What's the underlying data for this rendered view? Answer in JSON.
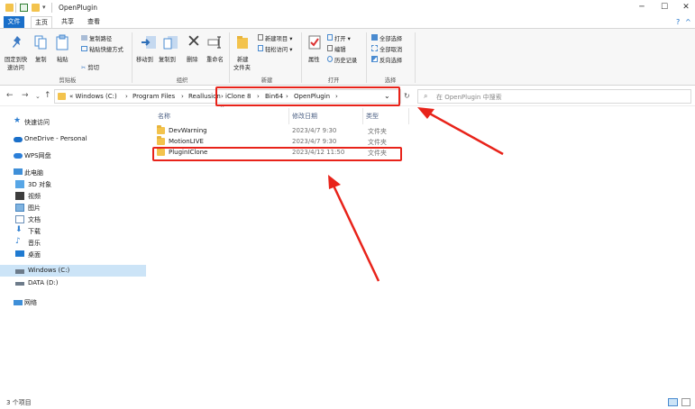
{
  "window": {
    "title": "OpenPlugin",
    "controls": {
      "minimize": "─",
      "maximize": "☐",
      "close": "✕"
    }
  },
  "tabs": [
    {
      "label": "文件",
      "kind": "file"
    },
    {
      "label": "主页",
      "kind": "active"
    },
    {
      "label": "共享",
      "kind": "normal"
    },
    {
      "label": "查看",
      "kind": "normal"
    }
  ],
  "ribbon": {
    "pin_quick_access": [
      "固定到快",
      "速访问"
    ],
    "copy": "复制",
    "paste": "粘贴",
    "copy_path": "复制路径",
    "paste_shortcut": "粘贴快捷方式",
    "cut": "剪切",
    "move_to": "移动到",
    "copy_to": "复制到",
    "delete": "删除",
    "rename": "重命名",
    "new_folder": [
      "新建",
      "文件夹"
    ],
    "new_item": "新建项目 ▾",
    "easy_access": "轻松访问 ▾",
    "properties": "属性",
    "open": "打开 ▾",
    "edit": "编辑",
    "history": "历史记录",
    "select_all": "全部选择",
    "select_none": "全部取消",
    "invert_selection": "反向选择",
    "groups": {
      "clipboard": "剪贴板",
      "organize": "组织",
      "new": "新建",
      "open": "打开",
      "select": "选择"
    }
  },
  "address": {
    "crumbs_left": [
      "«  Windows (C:)",
      "›",
      "Program Files",
      "›",
      "Reallusion"
    ],
    "crumbs_right": [
      "› iClone 8",
      "›",
      "Bin64",
      "›",
      "OpenPlugin",
      "›"
    ],
    "search_placeholder": "在 OpenPlugin 中搜索"
  },
  "sidebar": {
    "items": [
      {
        "label": "快速访问",
        "icon": "star-icon"
      },
      {
        "label": "OneDrive - Personal",
        "icon": "cloud-icon"
      },
      {
        "label": "WPS网盘",
        "icon": "cloud-icon"
      },
      {
        "label": "此电脑",
        "icon": "computer-icon"
      },
      {
        "label": "3D 对象",
        "icon": "cube-icon"
      },
      {
        "label": "视频",
        "icon": "video-icon"
      },
      {
        "label": "图片",
        "icon": "picture-icon"
      },
      {
        "label": "文档",
        "icon": "document-icon"
      },
      {
        "label": "下载",
        "icon": "download-icon"
      },
      {
        "label": "音乐",
        "icon": "music-icon"
      },
      {
        "label": "桌面",
        "icon": "desktop-icon"
      },
      {
        "label": "Windows (C:)",
        "icon": "drive-icon"
      },
      {
        "label": "DATA (D:)",
        "icon": "drive-icon"
      },
      {
        "label": "网络",
        "icon": "network-icon"
      }
    ]
  },
  "columns": {
    "name": "名称",
    "date": "修改日期",
    "type": "类型"
  },
  "files": [
    {
      "name": "DevWarning",
      "date": "2023/4/7 9:30",
      "type": "文件夹"
    },
    {
      "name": "MotionLIVE",
      "date": "2023/4/7 9:30",
      "type": "文件夹"
    },
    {
      "name": "PluginIClone",
      "date": "2023/4/12 11:50",
      "type": "文件夹"
    }
  ],
  "status": {
    "count": "3 个项目"
  },
  "colors": {
    "accent": "#1a6fc9",
    "annotation": "#e8231a",
    "folder": "#f3c34d",
    "selected": "#cce4f7"
  }
}
